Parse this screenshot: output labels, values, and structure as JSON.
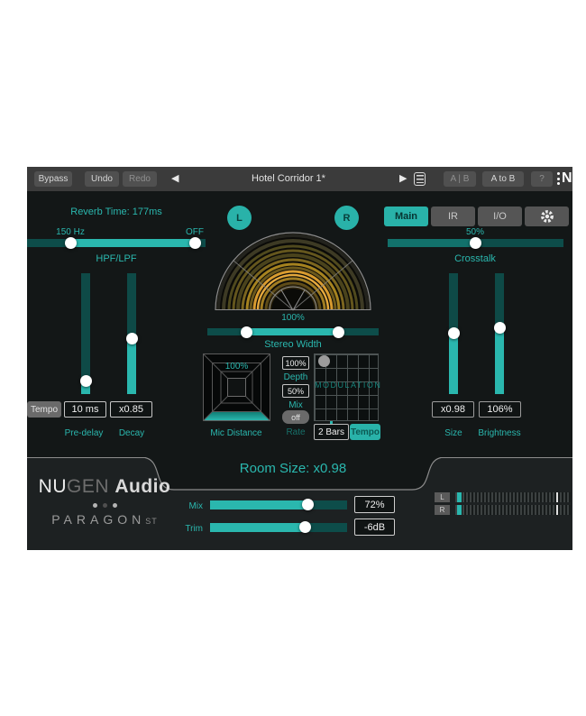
{
  "colors": {
    "accent": "#2ab7ae",
    "accent_dark": "#0d4d4a",
    "panel_bg": "#131717",
    "footer_bg": "#1d2122",
    "topbar_bg": "#3b3b3b",
    "radar_orange": "#e0a23a"
  },
  "topbar": {
    "bypass": "Bypass",
    "undo": "Undo",
    "redo": "Redo",
    "preset_name": "Hotel Corridor 1*",
    "ab_label": "A | B",
    "a_to_b_label": "A to B",
    "help_label": "?",
    "logo_letter": "N"
  },
  "left": {
    "reverb_time": "Reverb Time: 177ms",
    "hpf_value": "150 Hz",
    "lpf_value": "OFF",
    "filter_label": "HPF/LPF",
    "tempo_button": "Tempo",
    "predelay_value": "10 ms",
    "decay_value": "x0.85",
    "predelay_label": "Pre-delay",
    "decay_label": "Decay"
  },
  "center": {
    "solo_l": "L",
    "solo_r": "R",
    "stereo_width_value": "100%",
    "stereo_width_label": "Stereo Width",
    "mic_distance_value": "100%",
    "mic_distance_label": "Mic Distance",
    "modulation": {
      "depth_value": "100%",
      "depth_label": "Depth",
      "mix_value": "50%",
      "mix_label": "Mix",
      "mix_state": "off",
      "rate_label": "Rate",
      "grid_title": "MODULATION",
      "rate_value": "2 Bars",
      "sync_button": "Tempo"
    }
  },
  "right": {
    "tabs": [
      {
        "label": "Main"
      },
      {
        "label": "IR"
      },
      {
        "label": "I/O"
      }
    ],
    "crosstalk_value": "50%",
    "crosstalk_label": "Crosstalk",
    "size_value": "x0.98",
    "size_label": "Size",
    "brightness_value": "106%",
    "brightness_label": "Brightness"
  },
  "footer": {
    "room_size": "Room Size: x0.98",
    "brand_nu": "NU",
    "brand_gen": "GEN",
    "brand_audio": "Audio",
    "product_name": "PARAGON",
    "product_suffix": "ST",
    "mix_label": "Mix",
    "mix_value": "72%",
    "trim_label": "Trim",
    "trim_value": "-6dB",
    "meter_l": "L",
    "meter_r": "R"
  }
}
